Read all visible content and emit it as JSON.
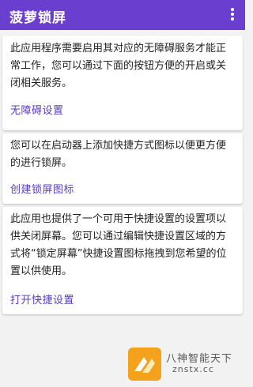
{
  "appbar": {
    "title": "菠萝锁屏",
    "menu_icon": "more-vert-icon",
    "color": "#6a3fd0"
  },
  "cards": [
    {
      "text": "此应用程序需要启用其对应的无障碍服务才能正常工作，您可以通过下面的按钮方便的开启或关闭相关服务。",
      "action_label": "无障碍设置"
    },
    {
      "text": "您可以在启动器上添加快捷方式图标以便更方便的进行锁屏。",
      "action_label": "创建锁屏图标"
    },
    {
      "text": "此应用也提供了一个可用于快捷设置的设置项以供关闭屏幕。您可以通过编辑快捷设置区域的方式将“锁定屏幕”快捷设置图标拖拽到您希望的位置以供使用。",
      "action_label": "打开快捷设置"
    }
  ],
  "watermark": {
    "title": "八神智能天下",
    "url": "znstx.cc"
  },
  "colors": {
    "accent": "#5a3bc4",
    "background": "#f2f2f2"
  }
}
